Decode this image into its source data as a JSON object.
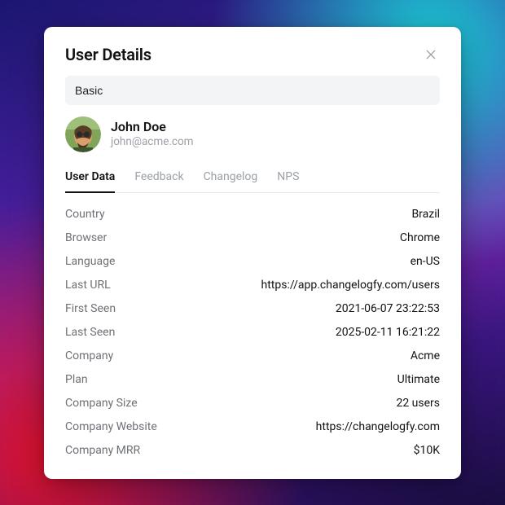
{
  "modal": {
    "title": "User Details",
    "search_value": "Basic"
  },
  "user": {
    "name": "John Doe",
    "email": "john@acme.com"
  },
  "tabs": [
    {
      "label": "User Data",
      "active": true
    },
    {
      "label": "Feedback",
      "active": false
    },
    {
      "label": "Changelog",
      "active": false
    },
    {
      "label": "NPS",
      "active": false
    }
  ],
  "details": [
    {
      "key": "Country",
      "value": "Brazil"
    },
    {
      "key": "Browser",
      "value": "Chrome"
    },
    {
      "key": "Language",
      "value": "en-US"
    },
    {
      "key": "Last URL",
      "value": "https://app.changelogfy.com/users"
    },
    {
      "key": "First Seen",
      "value": "2021-06-07 23:22:53"
    },
    {
      "key": "Last Seen",
      "value": "2025-02-11 16:21:22"
    },
    {
      "key": "Company",
      "value": "Acme"
    },
    {
      "key": "Plan",
      "value": "Ultimate"
    },
    {
      "key": "Company Size",
      "value": "22 users"
    },
    {
      "key": "Company Website",
      "value": "https://changelogfy.com"
    },
    {
      "key": "Company MRR",
      "value": "$10K"
    }
  ]
}
